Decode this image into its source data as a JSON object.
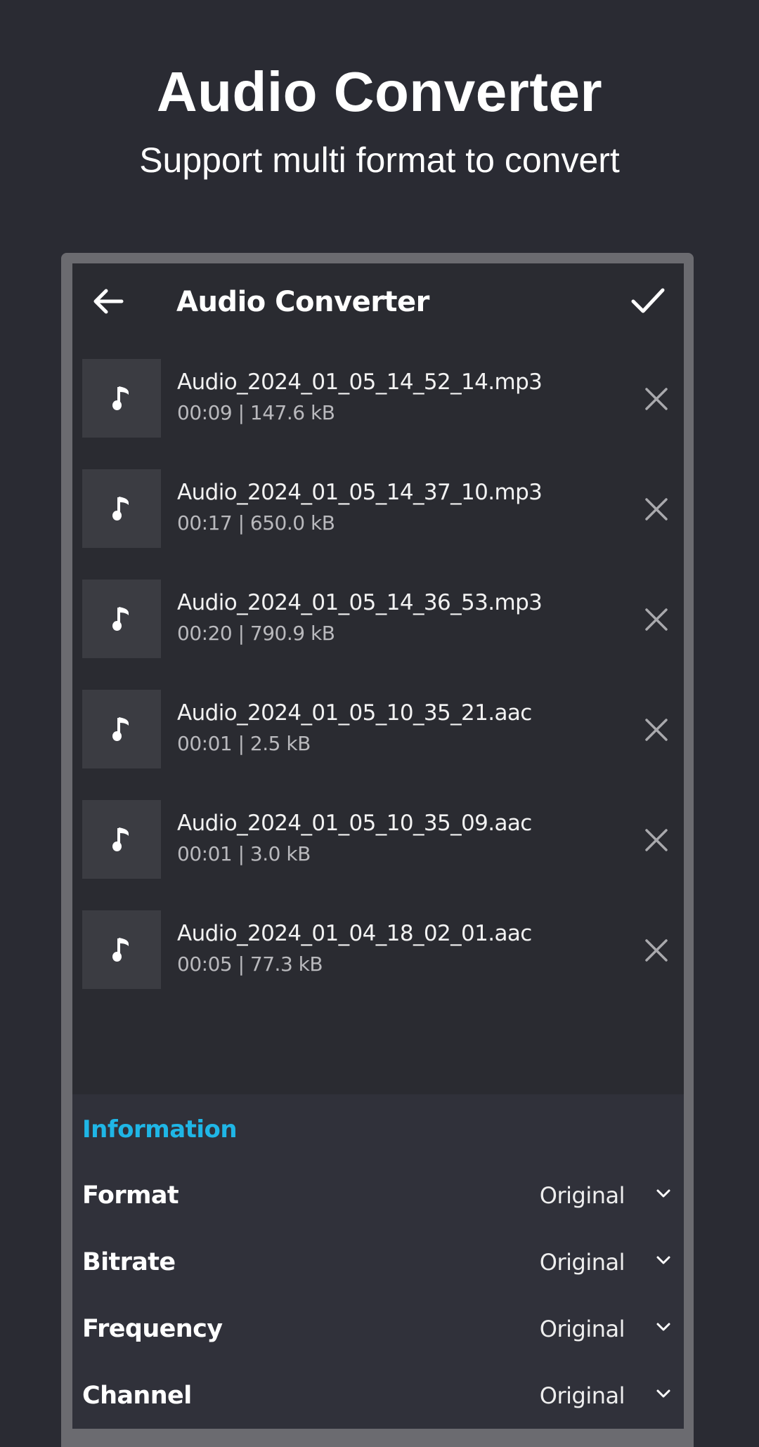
{
  "hero": {
    "title": "Audio Converter",
    "subtitle": "Support multi format to convert"
  },
  "appbar": {
    "title": "Audio Converter",
    "back_icon": "arrow-left-icon",
    "confirm_icon": "check-icon"
  },
  "files": [
    {
      "name": "Audio_2024_01_05_14_52_14.mp3",
      "meta": "00:09 | 147.6 kB"
    },
    {
      "name": "Audio_2024_01_05_14_37_10.mp3",
      "meta": "00:17 | 650.0 kB"
    },
    {
      "name": "Audio_2024_01_05_14_36_53.mp3",
      "meta": "00:20 | 790.9 kB"
    },
    {
      "name": "Audio_2024_01_05_10_35_21.aac",
      "meta": "00:01 | 2.5 kB"
    },
    {
      "name": "Audio_2024_01_05_10_35_09.aac",
      "meta": "00:01 | 3.0 kB"
    },
    {
      "name": "Audio_2024_01_04_18_02_01.aac",
      "meta": "00:05 | 77.3 kB"
    }
  ],
  "information": {
    "title": "Information",
    "rows": [
      {
        "label": "Format",
        "value": "Original"
      },
      {
        "label": "Bitrate",
        "value": "Original"
      },
      {
        "label": "Frequency",
        "value": "Original"
      },
      {
        "label": "Channel",
        "value": "Original"
      }
    ]
  },
  "colors": {
    "background": "#2a2b33",
    "accent": "#1fb6e6",
    "frame": "#6b6b70",
    "thumb": "#3b3c42",
    "info_panel": "#30313a"
  }
}
